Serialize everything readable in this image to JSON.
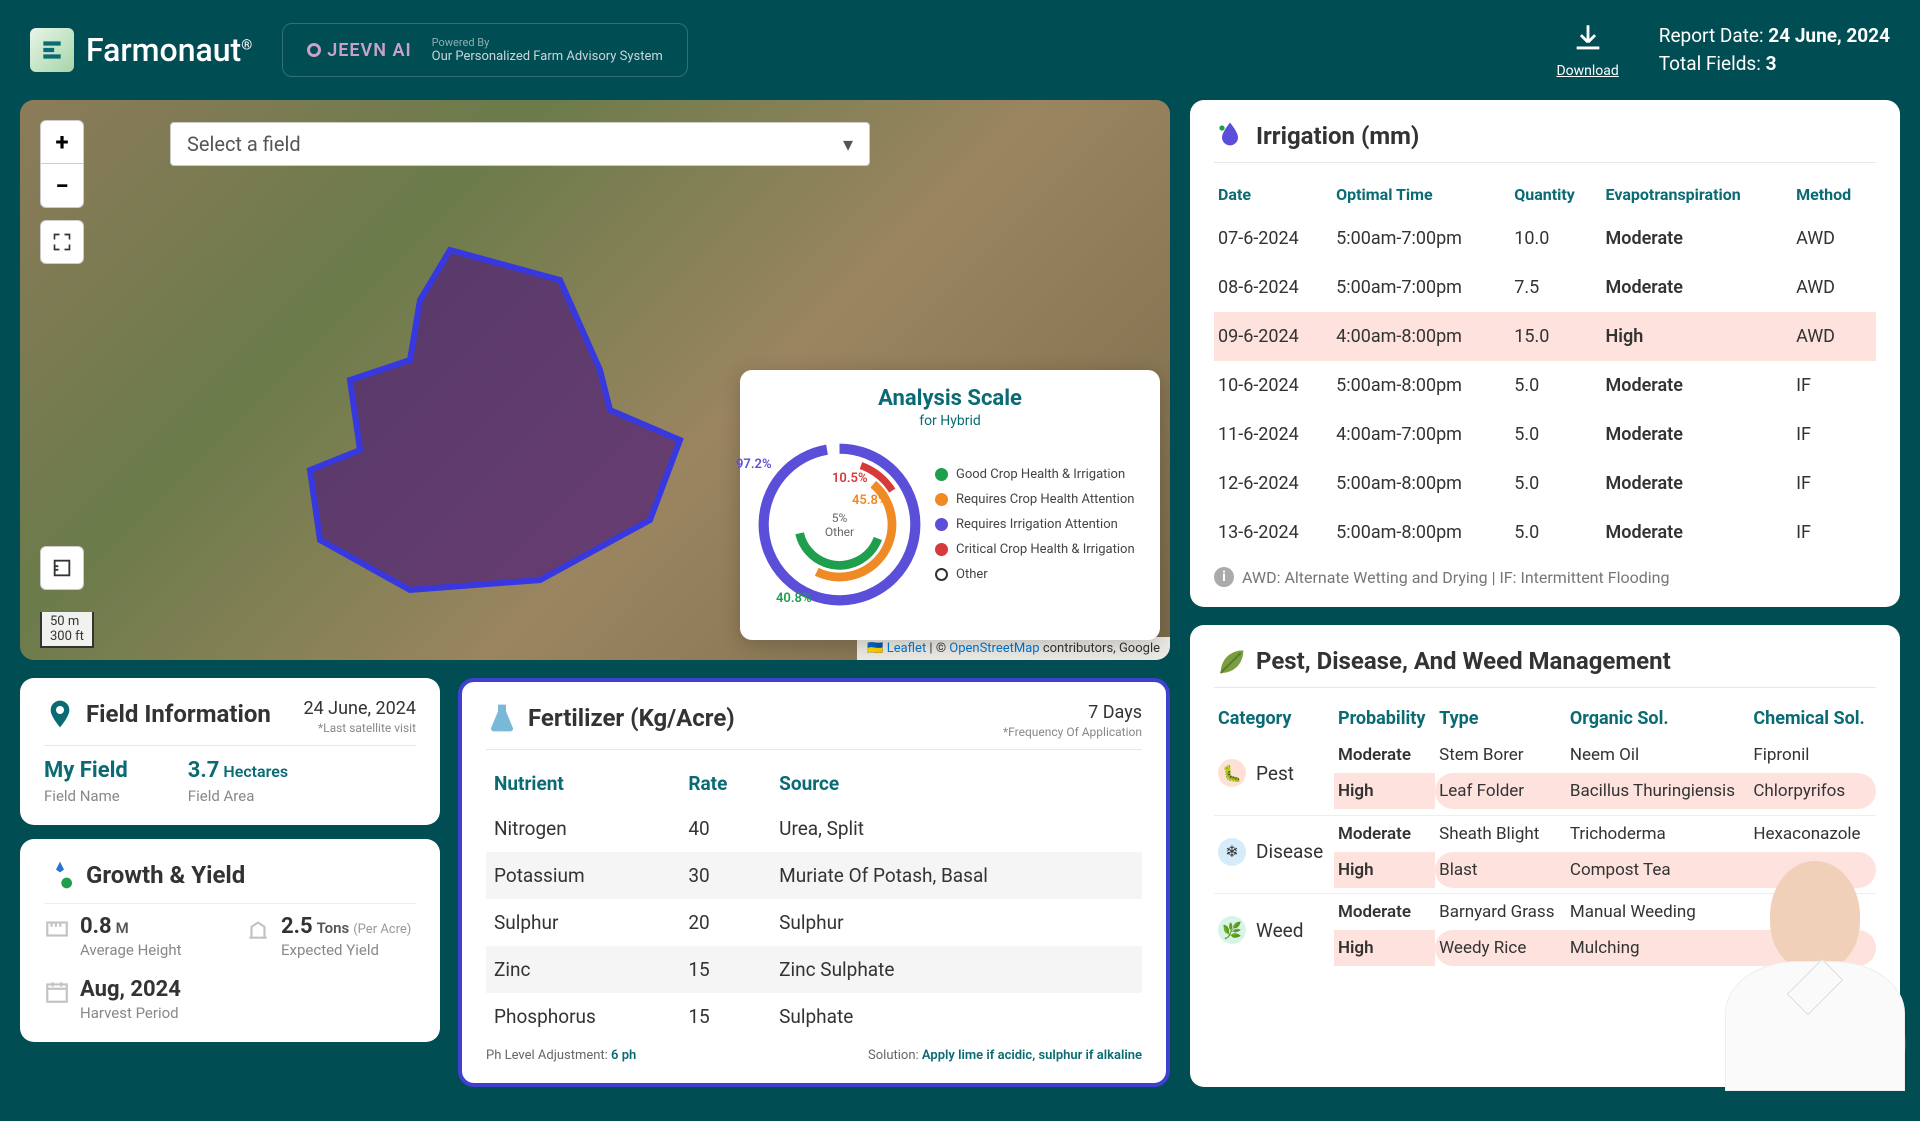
{
  "header": {
    "brand": "Farmonaut",
    "brand_tm": "®",
    "jeevn_label": "JEEVN AI",
    "powered_by": "Powered By",
    "tagline": "Our Personalized Farm Advisory System",
    "download": "Download",
    "report_date_label": "Report Date: ",
    "report_date": "24 June, 2024",
    "total_fields_label": "Total Fields: ",
    "total_fields": "3"
  },
  "map": {
    "select_placeholder": "Select a field",
    "scale1": "50 m",
    "scale2": "300 ft",
    "attr_leaflet": "Leaflet",
    "attr_osm": "OpenStreetMap",
    "attr_tail": " contributors, Google"
  },
  "chart_data": {
    "type": "pie",
    "title": "Analysis Scale",
    "subtitle": "for Hybrid",
    "center_label": "5%\nOther",
    "series": [
      {
        "name": "Good Crop Health & Irrigation",
        "value": 40.8,
        "label": "40.8%",
        "color": "#1f9e4d"
      },
      {
        "name": "Requires Crop Health Attention",
        "value": 45.8,
        "label": "45.8%",
        "color": "#f08a24"
      },
      {
        "name": "Requires Irrigation Attention",
        "value": 97.2,
        "label": "97.2%",
        "color": "#5b4ed8"
      },
      {
        "name": "Critical Crop Health & Irrigation",
        "value": 10.5,
        "label": "10.5%",
        "color": "#d63a3a"
      },
      {
        "name": "Other",
        "value": 5.0,
        "label": "5%",
        "color": "#ffffff"
      }
    ]
  },
  "field_info": {
    "title": "Field Information",
    "date": "24 June, 2024",
    "date_note": "*Last satellite visit",
    "name_val": "My Field",
    "name_lbl": "Field Name",
    "area_val": "3.7",
    "area_unit": "Hectares",
    "area_lbl": "Field Area"
  },
  "growth": {
    "title": "Growth & Yield",
    "height_val": "0.8",
    "height_unit": "M",
    "height_lbl": "Average Height",
    "yield_val": "2.5",
    "yield_unit": "Tons",
    "yield_note": "(Per Acre)",
    "yield_lbl": "Expected Yield",
    "harvest_val": "Aug, 2024",
    "harvest_lbl": "Harvest Period"
  },
  "fertilizer": {
    "title": "Fertilizer (Kg/Acre)",
    "freq": "7 Days",
    "freq_note": "*Frequency Of Application",
    "cols": [
      "Nutrient",
      "Rate",
      "Source"
    ],
    "rows": [
      {
        "n": "Nitrogen",
        "r": "40",
        "s": "Urea, Split"
      },
      {
        "n": "Potassium",
        "r": "30",
        "s": "Muriate Of Potash, Basal"
      },
      {
        "n": "Sulphur",
        "r": "20",
        "s": "Sulphur"
      },
      {
        "n": "Zinc",
        "r": "15",
        "s": "Zinc Sulphate"
      },
      {
        "n": "Phosphorus",
        "r": "15",
        "s": "Sulphate"
      }
    ],
    "ph_label": "Ph Level Adjustment: ",
    "ph_val": "6 ph",
    "sol_label": "Solution: ",
    "sol_val": "Apply lime if acidic, sulphur if alkaline"
  },
  "irrigation": {
    "title": "Irrigation (mm)",
    "cols": [
      "Date",
      "Optimal Time",
      "Quantity",
      "Evapotranspiration",
      "Method"
    ],
    "rows": [
      {
        "d": "07-6-2024",
        "t": "5:00am-7:00pm",
        "q": "10.0",
        "e": "Moderate",
        "m": "AWD",
        "lvl": "mod"
      },
      {
        "d": "08-6-2024",
        "t": "5:00am-7:00pm",
        "q": "7.5",
        "e": "Moderate",
        "m": "AWD",
        "lvl": "mod"
      },
      {
        "d": "09-6-2024",
        "t": "4:00am-8:00pm",
        "q": "15.0",
        "e": "High",
        "m": "AWD",
        "lvl": "high"
      },
      {
        "d": "10-6-2024",
        "t": "5:00am-8:00pm",
        "q": "5.0",
        "e": "Moderate",
        "m": "IF",
        "lvl": "mod"
      },
      {
        "d": "11-6-2024",
        "t": "4:00am-7:00pm",
        "q": "5.0",
        "e": "Moderate",
        "m": "IF",
        "lvl": "mod"
      },
      {
        "d": "12-6-2024",
        "t": "5:00am-8:00pm",
        "q": "5.0",
        "e": "Moderate",
        "m": "IF",
        "lvl": "mod"
      },
      {
        "d": "13-6-2024",
        "t": "5:00am-8:00pm",
        "q": "5.0",
        "e": "Moderate",
        "m": "IF",
        "lvl": "mod"
      }
    ],
    "footer": "AWD: Alternate Wetting and Drying | IF: Intermittent Flooding"
  },
  "pest": {
    "title": "Pest, Disease, And Weed Management",
    "cols": [
      "Category",
      "Probability",
      "Type",
      "Organic Sol.",
      "Chemical Sol."
    ],
    "groups": [
      {
        "cat": "Pest",
        "icon_bg": "#fde0d6",
        "icon": "🐛",
        "rows": [
          {
            "p": "Moderate",
            "t": "Stem Borer",
            "o": "Neem Oil",
            "c": "Fipronil",
            "lvl": "mod"
          },
          {
            "p": "High",
            "t": "Leaf Folder",
            "o": "Bacillus Thuringiensis",
            "c": "Chlorpyrifos",
            "lvl": "high"
          }
        ]
      },
      {
        "cat": "Disease",
        "icon_bg": "#d6ecfb",
        "icon": "❄",
        "rows": [
          {
            "p": "Moderate",
            "t": "Sheath Blight",
            "o": "Trichoderma",
            "c": "Hexaconazole",
            "lvl": "mod"
          },
          {
            "p": "High",
            "t": "Blast",
            "o": "Compost Tea",
            "c": "",
            "lvl": "high"
          }
        ]
      },
      {
        "cat": "Weed",
        "icon_bg": "#d6f5e6",
        "icon": "🌿",
        "rows": [
          {
            "p": "Moderate",
            "t": "Barnyard Grass",
            "o": "Manual Weeding",
            "c": "",
            "lvl": "mod"
          },
          {
            "p": "High",
            "t": "Weedy Rice",
            "o": "Mulching",
            "c": "",
            "lvl": "high"
          }
        ]
      }
    ]
  }
}
